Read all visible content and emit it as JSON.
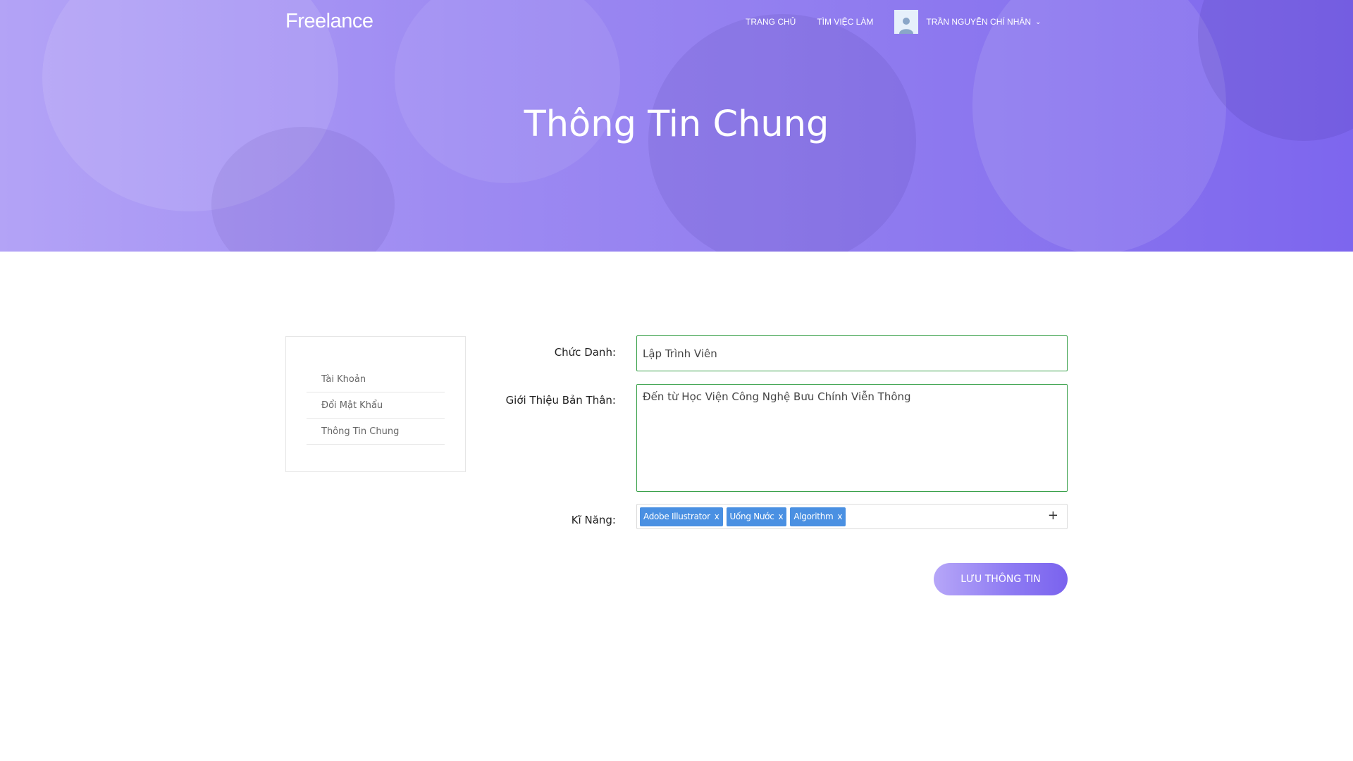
{
  "header": {
    "logo": "Freelance",
    "nav": [
      "TRANG CHỦ",
      "TÌM VIỆC LÀM"
    ],
    "user_name": "TRẦN NGUYỄN CHÍ NHÂN",
    "dropdown_icon": "chevron-down-icon",
    "avatar_icon": "user-icon"
  },
  "hero": {
    "title": "Thông Tin Chung"
  },
  "sidebar": {
    "items": [
      "Tài Khoản",
      "Đổi Mật Khẩu",
      "Thông Tin Chung"
    ]
  },
  "form": {
    "title_label": "Chức Danh:",
    "title_value": "Lập Trình Viên",
    "intro_label": "Giới Thiệu Bản Thân:",
    "intro_value": "Đến từ Học Viện Công Nghệ Bưu Chính Viễn Thông",
    "skills_label": "Kĩ Năng:",
    "skills": [
      "Adobe Illustrator",
      "Uống Nước",
      "Algorithm"
    ],
    "tag_remove": "x",
    "add_icon": "+",
    "save_label": "LƯU THÔNG TIN"
  },
  "colors": {
    "accent": "#8f7cf3",
    "tag": "#4a90e2",
    "focus_border": "#3aa14b"
  }
}
